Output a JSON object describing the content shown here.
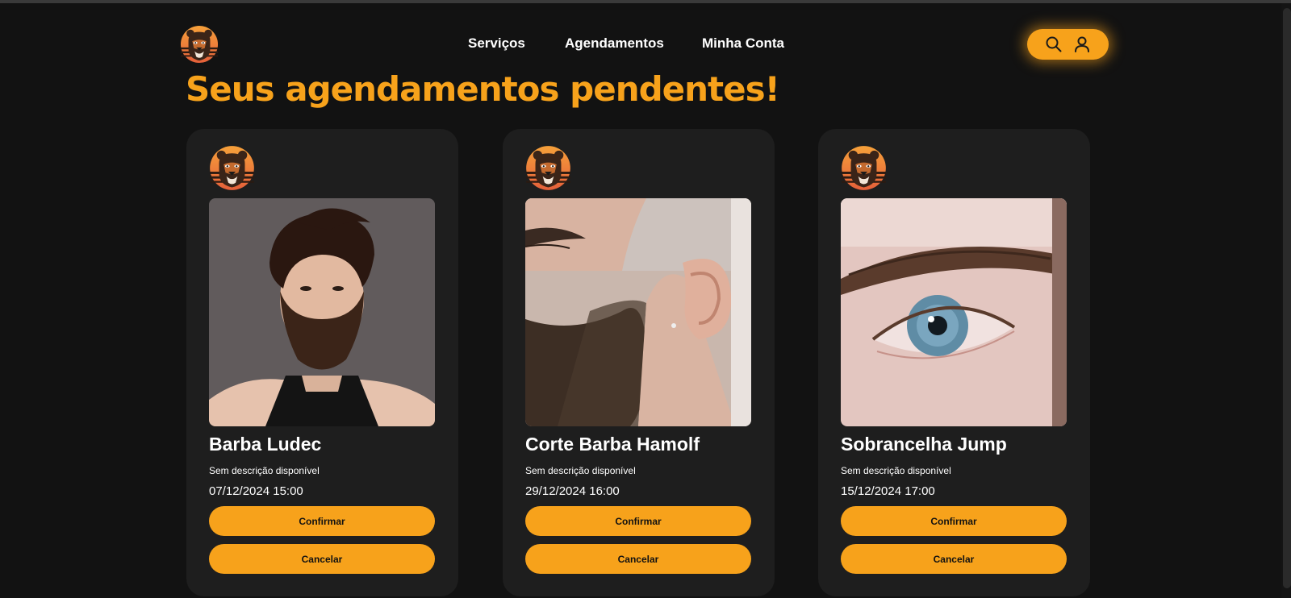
{
  "header": {
    "logo": "bear-logo",
    "nav": [
      {
        "label": "Serviços"
      },
      {
        "label": "Agendamentos"
      },
      {
        "label": "Minha Conta"
      }
    ],
    "actions": {
      "icons": [
        "search-icon",
        "user-icon"
      ],
      "background_color": "#f7a21b"
    }
  },
  "page_title": "Seus agendamentos pendentes!",
  "colors": {
    "accent": "#f7a21b",
    "background": "#121212",
    "card": "#1e1e1e"
  },
  "appointments": [
    {
      "title": "Barba Ludec",
      "description": "Sem descrição disponível",
      "datetime": "07/12/2024 15:00",
      "image": "bearded-man-photo",
      "confirm_label": "Confirmar",
      "cancel_label": "Cancelar"
    },
    {
      "title": "Corte Barba Hamolf",
      "description": "Sem descrição disponível",
      "datetime": "29/12/2024 16:00",
      "image": "beard-fade-closeup-photo",
      "confirm_label": "Confirmar",
      "cancel_label": "Cancelar"
    },
    {
      "title": "Sobrancelha Jump",
      "description": "Sem descrição disponível",
      "datetime": "15/12/2024 17:00",
      "image": "eyebrow-eye-closeup-photo",
      "confirm_label": "Confirmar",
      "cancel_label": "Cancelar"
    }
  ]
}
